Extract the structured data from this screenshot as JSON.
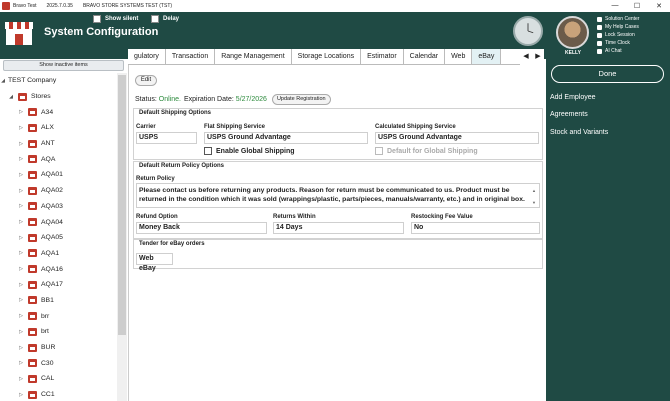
{
  "titlebar": {
    "app_name": "Bravo Test",
    "version": "2025.7.0.35",
    "system_name": "BRAVO STORE SYSTEMS TEST (TST)",
    "minimize": "—",
    "maximize": "☐",
    "close": "✕"
  },
  "header": {
    "title": "System Configuration",
    "show_silent_label": "Show silent",
    "delay_label": "Delay",
    "user_name": "KELLY",
    "quick_links": [
      "Solution Center",
      "My Help Cases",
      "Lock Session",
      "Time Clock",
      "AI Chat"
    ]
  },
  "left": {
    "show_inactive_label": "Show inactive items",
    "company": "TEST Company",
    "stores_label": "Stores",
    "stores": [
      "A34",
      "ALX",
      "ANT",
      "AQA",
      "AQA01",
      "AQA02",
      "AQA03",
      "AQA04",
      "AQA05",
      "AQA1",
      "AQA16",
      "AQA17",
      "BB1",
      "brr",
      "brt",
      "BUR",
      "C30",
      "CAL",
      "CC1"
    ]
  },
  "tabs": {
    "items": [
      "gulatory",
      "Transaction",
      "Range Management",
      "Storage Locations",
      "Estimator",
      "Calendar",
      "Web",
      "eBay"
    ],
    "active": "eBay",
    "prev": "◀",
    "next": "▶"
  },
  "main": {
    "edit_label": "Edit",
    "status_prefix": "Status:",
    "status_value": "Online.",
    "expiration_label": "Expiration Date:",
    "expiration_date": "5/27/2026",
    "update_label": "Update Registration",
    "shipping": {
      "title": "Default Shipping Options",
      "carrier_label": "Carrier",
      "carrier_value": "USPS",
      "flat_label": "Flat Shipping Service",
      "flat_value": "USPS Ground Advantage",
      "enable_global_label": "Enable Global Shipping",
      "calc_label": "Calculated Shipping Service",
      "calc_value": "USPS Ground Advantage",
      "default_global_label": "Default for Global Shipping"
    },
    "returns": {
      "title": "Default Return Policy Options",
      "policy_label": "Return Policy",
      "policy_text": "Please contact us before returning any products. Reason for return must be communicated to us. Product must be returned in the condition which it was sold (wrappings/plastic, parts/pieces, manuals/warranty, etc.) and in original box.",
      "refund_label": "Refund Option",
      "refund_value": "Money Back",
      "within_label": "Returns Within",
      "within_value": "14 Days",
      "restock_label": "Restocking Fee Value",
      "restock_value": "No"
    },
    "tender": {
      "title": "Tender for eBay orders",
      "value": "Web eBay"
    }
  },
  "right": {
    "done_label": "Done",
    "actions": [
      "Add Employee",
      "Agreements",
      "Stock and Variants"
    ]
  }
}
